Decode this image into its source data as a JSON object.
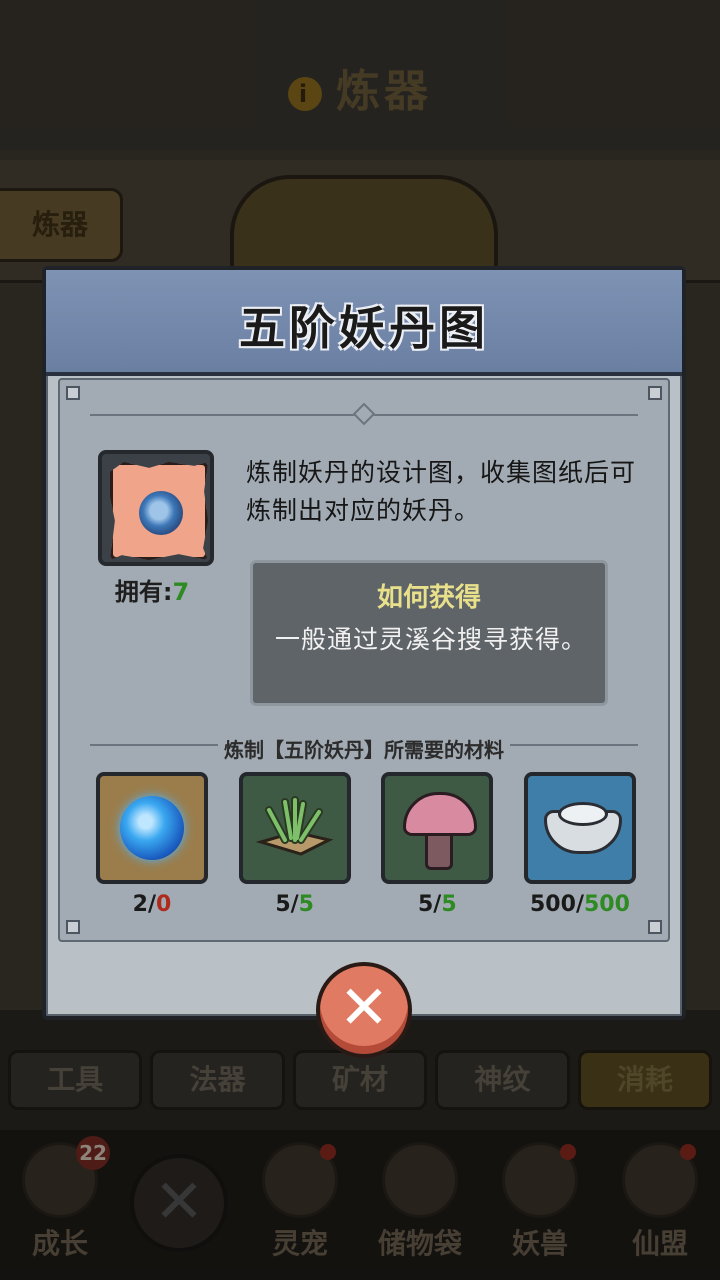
{
  "background": {
    "screen_title": "炼器",
    "info_icon": "i",
    "side_tab": "炼器",
    "tabs": [
      "工具",
      "法器",
      "矿材",
      "神纹",
      "消耗"
    ],
    "nav": [
      {
        "label": "成长",
        "badge": "22"
      },
      {
        "label": ""
      },
      {
        "label": "灵宠"
      },
      {
        "label": "储物袋"
      },
      {
        "label": "妖兽"
      },
      {
        "label": "仙盟"
      }
    ]
  },
  "modal": {
    "title": "五阶妖丹图",
    "item_icon": "demon-pill-blueprint-icon",
    "owned_label": "拥有:",
    "owned_value": "7",
    "description": "炼制妖丹的设计图，收集图纸后可炼制出对应的妖丹。",
    "how_to_get_title": "如何获得",
    "how_to_get_text": "一般通过灵溪谷搜寻获得。",
    "materials_caption": "炼制【五阶妖丹】所需要的材料",
    "materials": [
      {
        "icon": "blue-orb-icon",
        "have": "2",
        "need": "0",
        "status": "insufficient",
        "bg": "#9b7d4c"
      },
      {
        "icon": "herb-icon",
        "have": "5",
        "need": "5",
        "status": "enough",
        "bg": "#3e5a44"
      },
      {
        "icon": "mushroom-icon",
        "have": "5",
        "need": "5",
        "status": "enough",
        "bg": "#3e5a44"
      },
      {
        "icon": "silver-ingot-icon",
        "have": "500",
        "need": "500",
        "status": "enough",
        "bg": "#3f7ea8"
      }
    ],
    "close_glyph": "✕"
  },
  "colors": {
    "header_blue": "#7e93b4",
    "enough_green": "#2e8a22",
    "insufficient_red": "#b02a1c",
    "how_title_yellow": "#e8e08a"
  }
}
